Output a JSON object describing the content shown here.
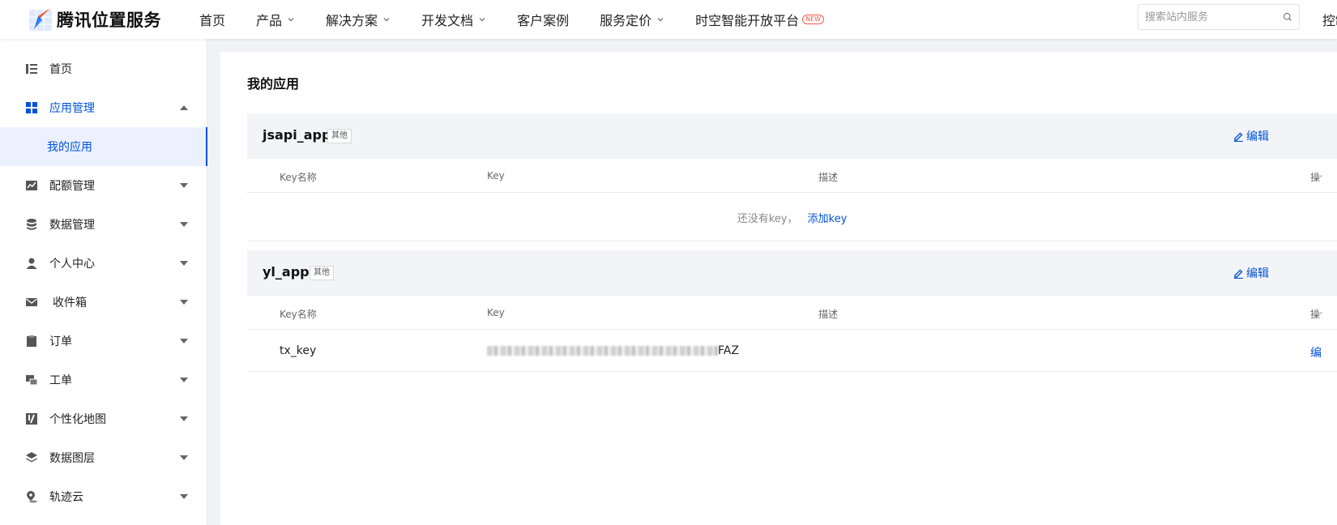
{
  "brand": {
    "name": "腾讯位置服务"
  },
  "nav": [
    {
      "label": "首页",
      "dropdown": false
    },
    {
      "label": "产品",
      "dropdown": true
    },
    {
      "label": "解决方案",
      "dropdown": true
    },
    {
      "label": "开发文档",
      "dropdown": true
    },
    {
      "label": "客户案例",
      "dropdown": false
    },
    {
      "label": "服务定价",
      "dropdown": true
    },
    {
      "label": "时空智能开放平台",
      "dropdown": false,
      "badge": "NEW"
    }
  ],
  "search": {
    "placeholder": "搜索站内服务"
  },
  "console_label": "控制台",
  "sidebar": {
    "items": [
      {
        "label": "首页",
        "icon": "list-icon"
      },
      {
        "label": "应用管理",
        "icon": "grid-icon",
        "expanded": true
      },
      {
        "label": "配额管理",
        "icon": "chart-icon"
      },
      {
        "label": "数据管理",
        "icon": "database-icon"
      },
      {
        "label": "个人中心",
        "icon": "user-icon"
      },
      {
        "label": "收件箱",
        "icon": "mail-icon"
      },
      {
        "label": "订单",
        "icon": "clipboard-icon"
      },
      {
        "label": "工单",
        "icon": "ticket-icon"
      },
      {
        "label": "个性化地图",
        "icon": "map-style-icon"
      },
      {
        "label": "数据图层",
        "icon": "layers-icon"
      },
      {
        "label": "轨迹云",
        "icon": "location-icon"
      }
    ],
    "sub_item": "我的应用"
  },
  "main": {
    "title": "我的应用",
    "columns": {
      "name": "Key名称",
      "key": "Key",
      "desc": "描述",
      "op": "操作"
    },
    "apps": [
      {
        "name": "jsapi_app",
        "tag": "其他",
        "edit": "编辑",
        "empty_text": "还没有key，",
        "add_label": "添加key"
      },
      {
        "name": "yl_app",
        "tag": "其他",
        "edit": "编辑",
        "row": {
          "key_name": "tx_key",
          "key_suffix": "FAZ",
          "op": "编辑"
        }
      }
    ]
  },
  "colors": {
    "accent": "#0052d9",
    "logo_orange": "#f25b2a",
    "logo_blue": "#1d6ff2"
  }
}
